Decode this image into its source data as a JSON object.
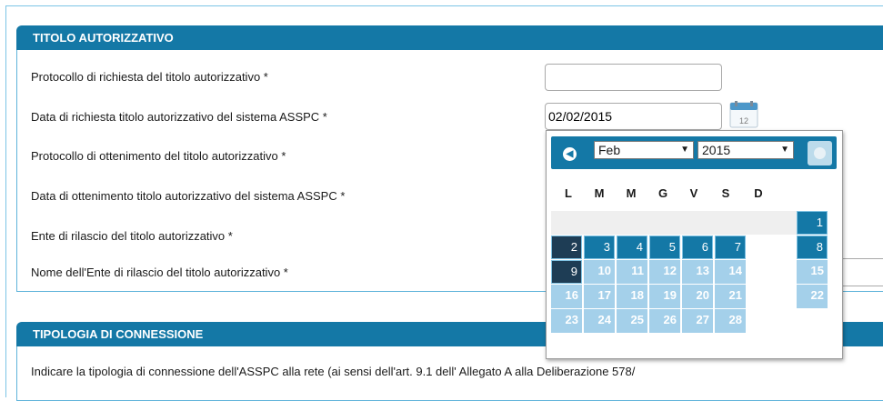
{
  "section1": {
    "title": "TITOLO AUTORIZZATIVO",
    "rows": [
      {
        "label": "Protocollo di richiesta del titolo autorizzativo *"
      },
      {
        "label": "Data di richiesta titolo autorizzativo del sistema ASSPC *"
      },
      {
        "label": "Protocollo di ottenimento del titolo autorizzativo *"
      },
      {
        "label": "Data di ottenimento titolo autorizzativo del sistema ASSPC *"
      },
      {
        "label": "Ente di rilascio del titolo autorizzativo *"
      },
      {
        "label": "Nome dell'Ente di rilascio del titolo autorizzativo *"
      }
    ],
    "protocollo_richiesta_value": "",
    "data_richiesta_value": "02/02/2015",
    "calendar_icon_text": "12"
  },
  "section2": {
    "title": "TIPOLOGIA DI CONNESSIONE",
    "description": "Indicare la tipologia di connessione dell'ASSPC alla rete (ai sensi dell'art. 9.1 dell' Allegato A alla Deliberazione 578/"
  },
  "datepicker": {
    "prev_icon": "chevron-left-icon",
    "next_icon": "chevron-right-icon",
    "month": "Feb",
    "year": "2015",
    "weekdays": [
      "L",
      "M",
      "M",
      "G",
      "V",
      "S",
      "D"
    ],
    "days": [
      [
        "",
        "",
        "",
        "",
        "",
        "",
        "1"
      ],
      [
        "2",
        "3",
        "4",
        "5",
        "6",
        "7",
        "8"
      ],
      [
        "9",
        "10",
        "11",
        "12",
        "13",
        "14",
        "15"
      ],
      [
        "16",
        "17",
        "18",
        "19",
        "20",
        "21",
        "22"
      ],
      [
        "23",
        "24",
        "25",
        "26",
        "27",
        "28",
        ""
      ]
    ],
    "selected_day": "2",
    "today_day": "9"
  },
  "colors": {
    "header_blue": "#1478a6",
    "selected_dark": "#1e3d55",
    "future_light": "#a4d0ea"
  }
}
